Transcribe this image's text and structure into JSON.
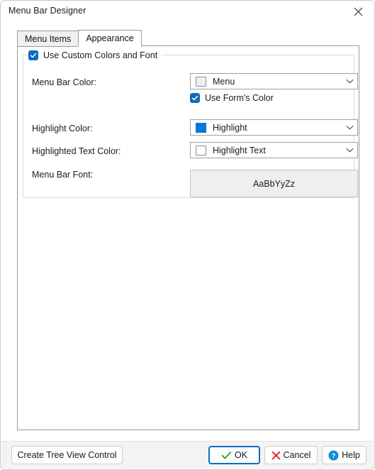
{
  "window": {
    "title": "Menu Bar Designer",
    "close_icon": "close-icon"
  },
  "tabs": [
    {
      "label": "Menu Items",
      "selected": false
    },
    {
      "label": "Appearance",
      "selected": true
    }
  ],
  "group": {
    "legend": "Use Custom Colors and Font",
    "legend_checked": true
  },
  "fields": {
    "menu_bar_color": {
      "label": "Menu Bar Color:",
      "value": "Menu",
      "swatch_color": "#f0f0f0"
    },
    "use_forms_color": {
      "label": "Use Form's Color",
      "checked": true
    },
    "highlight_color": {
      "label": "Highlight Color:",
      "value": "Highlight",
      "swatch_color": "#0078d7"
    },
    "highlighted_text_color": {
      "label": "Highlighted Text Color:",
      "value": "Highlight Text",
      "swatch_color": "#ffffff"
    },
    "menu_bar_font": {
      "label": "Menu Bar Font:",
      "preview": "AaBbYyZz"
    }
  },
  "footer": {
    "create_tree_view": "Create Tree View Control",
    "ok": "OK",
    "cancel": "Cancel",
    "help": "Help"
  },
  "colors": {
    "accent": "#0f6cbd",
    "highlight_blue": "#0078d7",
    "ok_check_green": "#1e9e1e",
    "cancel_x_red": "#e81123",
    "help_blue": "#0f8cdb"
  }
}
